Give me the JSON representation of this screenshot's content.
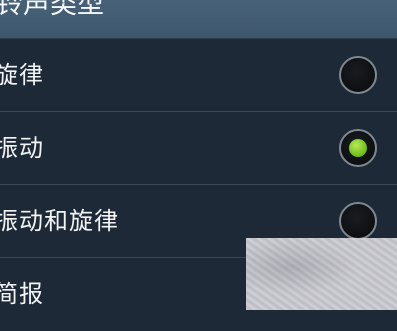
{
  "header": {
    "title": "铃声类型"
  },
  "options": [
    {
      "label": "旋律",
      "selected": false
    },
    {
      "label": "振动",
      "selected": true
    },
    {
      "label": "振动和旋律",
      "selected": false
    },
    {
      "label": "简报",
      "selected": false
    }
  ],
  "colors": {
    "background": "#1d2936",
    "header": "#435c72",
    "selected_indicator": "#7cc622",
    "divider": "#3a4856"
  }
}
